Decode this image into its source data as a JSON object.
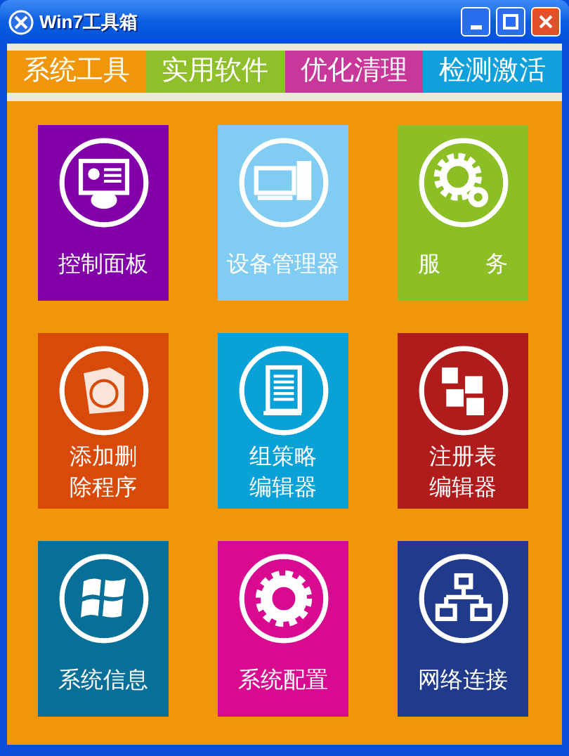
{
  "window": {
    "title": "Win7工具箱"
  },
  "tabs": [
    {
      "label": "系统工具",
      "color": "#f0960a"
    },
    {
      "label": "实用软件",
      "color": "#8fbf2a"
    },
    {
      "label": "优化清理",
      "color": "#c7389a"
    },
    {
      "label": "检测激活",
      "color": "#10a0dc"
    }
  ],
  "tiles": [
    {
      "label_lines": [
        "控制面板"
      ],
      "color": "#8200a8"
    },
    {
      "label_lines": [
        "设备管理器"
      ],
      "color": "#80ccf2"
    },
    {
      "label_lines": [
        "服　　务"
      ],
      "color": "#8cbf26"
    },
    {
      "label_lines": [
        "添加删",
        "除程序"
      ],
      "color": "#d84a0a"
    },
    {
      "label_lines": [
        "组策略",
        "编辑器"
      ],
      "color": "#0aa0d8"
    },
    {
      "label_lines": [
        "注册表",
        "编辑器"
      ],
      "color": "#b01c1c"
    },
    {
      "label_lines": [
        "系统信息"
      ],
      "color": "#087098"
    },
    {
      "label_lines": [
        "系统配置"
      ],
      "color": "#d80a90"
    },
    {
      "label_lines": [
        "网络连接"
      ],
      "color": "#203a8c"
    }
  ]
}
